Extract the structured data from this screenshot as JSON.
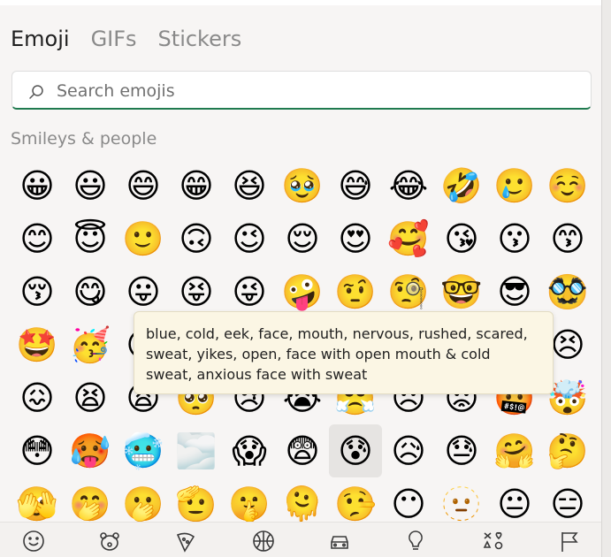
{
  "tabs": [
    {
      "label": "Emoji",
      "active": true
    },
    {
      "label": "GIFs",
      "active": false
    },
    {
      "label": "Stickers",
      "active": false
    }
  ],
  "search": {
    "placeholder": "Search emojis",
    "value": ""
  },
  "section_title": "Smileys & people",
  "emojis": [
    "😀",
    "😃",
    "😄",
    "😁",
    "😆",
    "🥹",
    "😅",
    "😂",
    "🤣",
    "🥲",
    "☺️",
    "😊",
    "😇",
    "🙂",
    "🙃",
    "😉",
    "😌",
    "😍",
    "🥰",
    "😘",
    "😗",
    "😙",
    "😚",
    "😋",
    "😛",
    "😝",
    "😜",
    "🤪",
    "🤨",
    "🧐",
    "🤓",
    "😎",
    "🥸",
    "🤩",
    "🥳",
    "😏",
    "😒",
    "😞",
    "😔",
    "😟",
    "😕",
    "🙁",
    "☹️",
    "😣",
    "😖",
    "😫",
    "😩",
    "🥺",
    "😢",
    "😭",
    "😤",
    "😠",
    "😡",
    "🤬",
    "🤯",
    "😳",
    "🥵",
    "🥶",
    "🌫️",
    "😱",
    "😨",
    "😰",
    "😥",
    "😓",
    "🤗",
    "🤔",
    "🫣",
    "🤭",
    "🫢",
    "🫡",
    "🤫",
    "🫠",
    "🤥",
    "😶",
    "🫥",
    "😐",
    "😑"
  ],
  "hovered_index": 61,
  "tooltip": "blue, cold, eek, face, mouth, nervous, rushed, scared, sweat, yikes, open, face with open mouth & cold sweat, anxious face with sweat",
  "categories": [
    "smiley-icon",
    "animal-icon",
    "food-icon",
    "activity-icon",
    "travel-icon",
    "objects-icon",
    "symbols-icon",
    "flags-icon"
  ]
}
